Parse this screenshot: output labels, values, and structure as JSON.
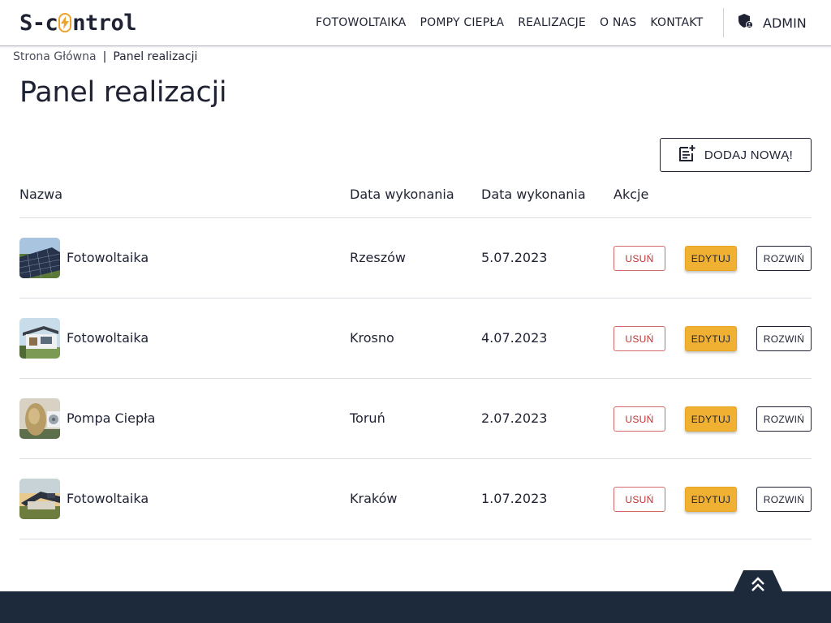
{
  "brand": {
    "logo_left": "S-c",
    "logo_right": "ntrol",
    "accent": "#f0a32a"
  },
  "nav": {
    "items": [
      "FOTOWOLTAIKA",
      "POMPY CIEPŁA",
      "REALIZACJE",
      "O NAS",
      "KONTAKT"
    ],
    "admin_label": "ADMIN",
    "admin_icon": "shield-user-icon"
  },
  "breadcrumb": {
    "home": "Strona Główna",
    "separator": "|",
    "current": "Panel realizacji"
  },
  "page": {
    "title": "Panel realizacji",
    "add_button": "DODAJ NOWĄ!",
    "add_icon": "note-add-icon"
  },
  "table": {
    "headers": [
      "Nazwa",
      "Data wykonania",
      "Data wykonania",
      "Akcje"
    ],
    "rows": [
      {
        "name": "Fotowoltaika",
        "location": "Rzeszów",
        "date": "5.07.2023",
        "thumb": "solar-field"
      },
      {
        "name": "Fotowoltaika",
        "location": "Krosno",
        "date": "4.07.2023",
        "thumb": "modern-house"
      },
      {
        "name": "Pompa Ciepła",
        "location": "Toruń",
        "date": "2.07.2023",
        "thumb": "heat-pump"
      },
      {
        "name": "Fotowoltaika",
        "location": "Kraków",
        "date": "1.07.2023",
        "thumb": "solar-roof"
      }
    ],
    "actions": {
      "delete": "USUŃ",
      "edit": "EDYTUJ",
      "expand": "ROZWIŃ"
    }
  },
  "colors": {
    "delete": "#c62f2f",
    "edit_bg": "#f0b132",
    "footer": "#1c2a3b",
    "text": "#1e2233"
  }
}
